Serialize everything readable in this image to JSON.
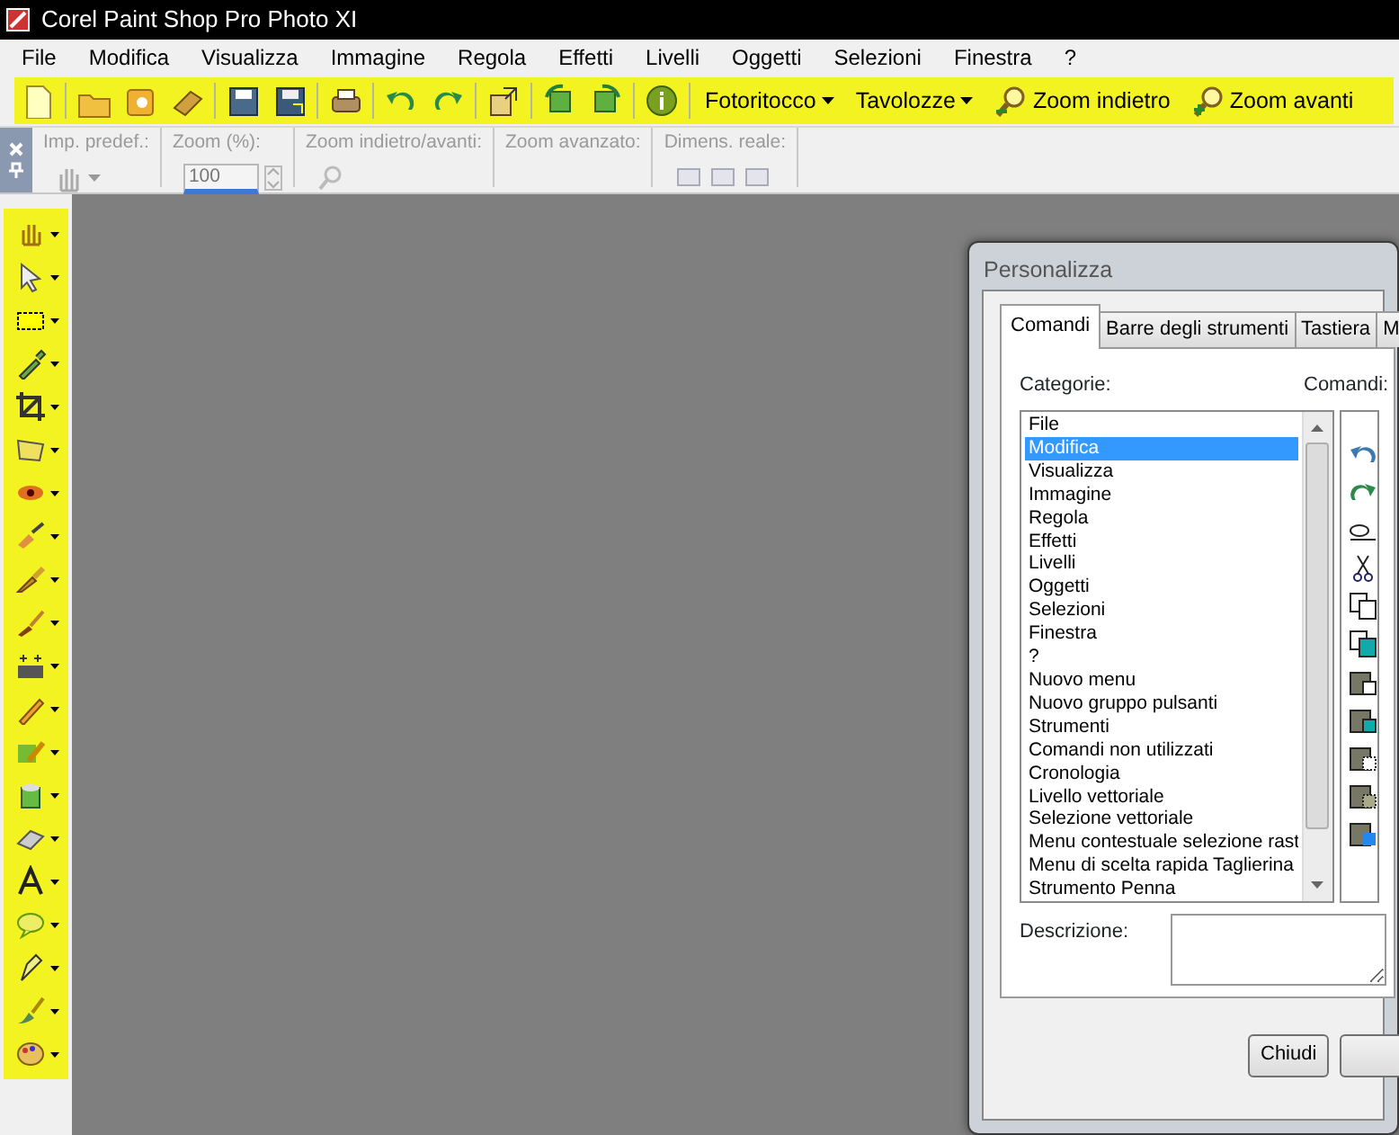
{
  "window": {
    "title": "Corel Paint Shop Pro Photo XI"
  },
  "menu": [
    "File",
    "Modifica",
    "Visualizza",
    "Immagine",
    "Regola",
    "Effetti",
    "Livelli",
    "Oggetti",
    "Selezioni",
    "Finestra",
    "?"
  ],
  "toolbar": [
    {
      "kind": "new"
    },
    {
      "kind": "sep"
    },
    {
      "kind": "open"
    },
    {
      "kind": "browse"
    },
    {
      "kind": "scan"
    },
    {
      "kind": "sep"
    },
    {
      "kind": "save"
    },
    {
      "kind": "saveas"
    },
    {
      "kind": "sep"
    },
    {
      "kind": "print"
    },
    {
      "kind": "sep"
    },
    {
      "kind": "undo"
    },
    {
      "kind": "redo"
    },
    {
      "kind": "sep"
    },
    {
      "kind": "resize"
    },
    {
      "kind": "sep"
    },
    {
      "kind": "rotate"
    },
    {
      "kind": "rotate2"
    },
    {
      "kind": "sep"
    },
    {
      "kind": "info"
    },
    {
      "kind": "sep"
    },
    {
      "kind": "menu",
      "label": "Fotoritocco"
    },
    {
      "kind": "menu",
      "label": "Tavolozze"
    },
    {
      "kind": "zoomout",
      "label": "Zoom indietro"
    },
    {
      "kind": "zoomin",
      "label": "Zoom avanti"
    }
  ],
  "options_bar": {
    "groups": [
      {
        "label": "Imp. predef.:"
      },
      {
        "label": "Zoom (%):",
        "value": "100"
      },
      {
        "label": "Zoom indietro/avanti:"
      },
      {
        "label": "Zoom avanzato:"
      },
      {
        "label": "Dimens. reale:"
      }
    ]
  },
  "dialog": {
    "title": "Personalizza",
    "tabs": [
      {
        "label": "Comandi",
        "selected": true
      },
      {
        "label": "Barre degli strumenti",
        "selected": false
      },
      {
        "label": "Tastiera",
        "selected": false
      },
      {
        "label": "M",
        "selected": false
      }
    ],
    "categories_label": "Categorie:",
    "categories": [
      {
        "label": "File",
        "selected": false
      },
      {
        "label": "Modifica",
        "selected": true
      },
      {
        "label": "Visualizza",
        "selected": false
      },
      {
        "label": "Immagine",
        "selected": false
      },
      {
        "label": "Regola",
        "selected": false
      },
      {
        "label": "Effetti",
        "selected": false
      },
      {
        "label": "Livelli",
        "selected": false
      },
      {
        "label": "Oggetti",
        "selected": false
      },
      {
        "label": "Selezioni",
        "selected": false
      },
      {
        "label": "Finestra",
        "selected": false
      },
      {
        "label": "?",
        "selected": false
      },
      {
        "label": "Nuovo menu",
        "selected": false
      },
      {
        "label": "Nuovo gruppo pulsanti",
        "selected": false
      },
      {
        "label": "Strumenti",
        "selected": false
      },
      {
        "label": "Comandi non utilizzati",
        "selected": false
      },
      {
        "label": "Cronologia",
        "selected": false
      },
      {
        "label": "Livello vettoriale",
        "selected": false
      },
      {
        "label": "Selezione vettoriale",
        "selected": false
      },
      {
        "label": "Menu contestuale selezione rast",
        "selected": false
      },
      {
        "label": "Menu di scelta rapida Taglierina",
        "selected": false
      },
      {
        "label": "Strumento Penna",
        "selected": false
      }
    ],
    "commands_label": "Comandi:",
    "description_label": "Descrizione:",
    "buttons": [
      "Chiudi"
    ]
  }
}
